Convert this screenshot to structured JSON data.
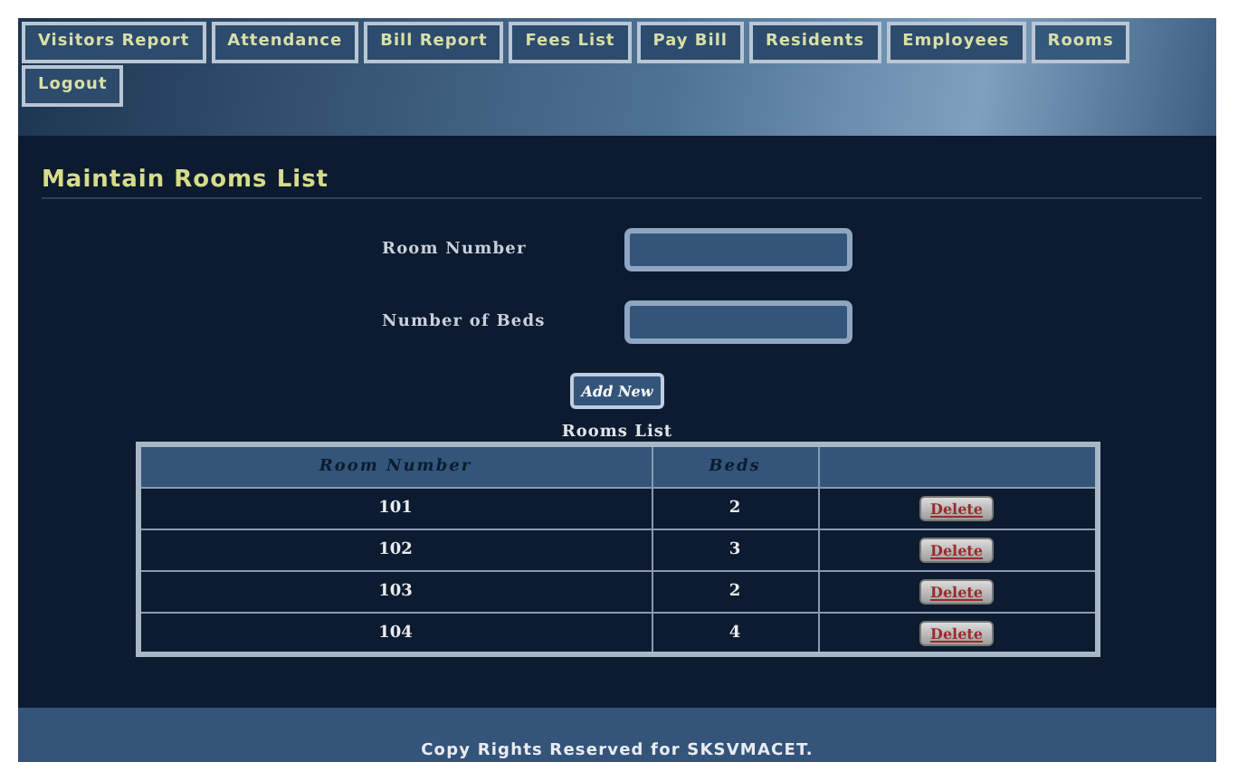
{
  "nav": [
    {
      "label": "Visitors Report",
      "selected": false
    },
    {
      "label": "Attendance",
      "selected": false
    },
    {
      "label": "Bill Report",
      "selected": false
    },
    {
      "label": "Fees List",
      "selected": false
    },
    {
      "label": "Pay Bill",
      "selected": false
    },
    {
      "label": "Residents",
      "selected": false
    },
    {
      "label": "Employees",
      "selected": false
    },
    {
      "label": "Rooms",
      "selected": true
    },
    {
      "label": "Logout",
      "selected": false
    }
  ],
  "title": "Maintain Rooms List",
  "form": {
    "fields": [
      {
        "label": "Room Number"
      },
      {
        "label": "Number of Beds"
      }
    ],
    "button": "Add New"
  },
  "table": {
    "caption": "Rooms List",
    "columns": [
      "Room Number",
      "Beds"
    ],
    "rows": [
      {
        "room": "101",
        "beds": "2",
        "action": "Delete"
      },
      {
        "room": "102",
        "beds": "3",
        "action": "Delete"
      },
      {
        "room": "103",
        "beds": "2",
        "action": "Delete"
      },
      {
        "room": "104",
        "beds": "4",
        "action": "Delete"
      }
    ]
  },
  "footer": "Copy Rights Reserved for SKSVMACET."
}
